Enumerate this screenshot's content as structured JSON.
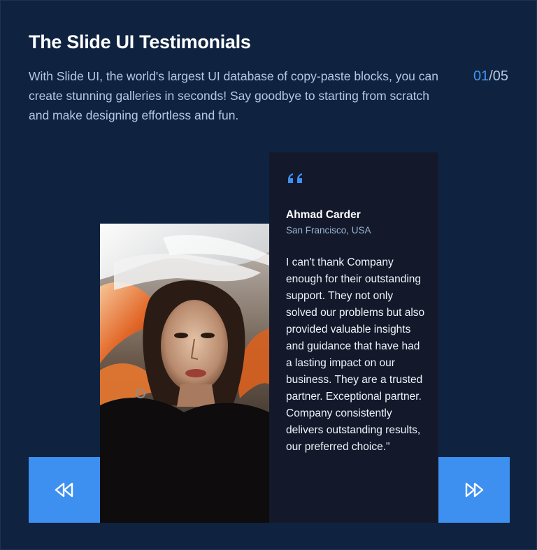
{
  "header": {
    "title": "The Slide UI Testimonials",
    "description": "With Slide UI, the world's largest UI database of copy-paste blocks, you can create stunning galleries in seconds! Say goodbye to starting from scratch and make designing effortless and fun."
  },
  "pagination": {
    "current": "01",
    "separator": "/",
    "total": "05"
  },
  "testimonial": {
    "author_name": "Ahmad Carder",
    "author_location": "San Francisco, USA",
    "quote": "I can't thank Company enough for their outstanding support. They not only solved our problems but also provided valuable insights and guidance that have had a lasting impact on our business. They are a trusted partner. Exceptional partner. Company consistently delivers outstanding results, our preferred choice.\"",
    "quote_icon": "quote-icon"
  },
  "navigation": {
    "prev_icon": "rewind-icon",
    "next_icon": "fast-forward-icon"
  },
  "colors": {
    "background": "#0f2341",
    "accent": "#3d8ff0",
    "card": "#13192b",
    "muted_text": "#b3c8e3"
  }
}
